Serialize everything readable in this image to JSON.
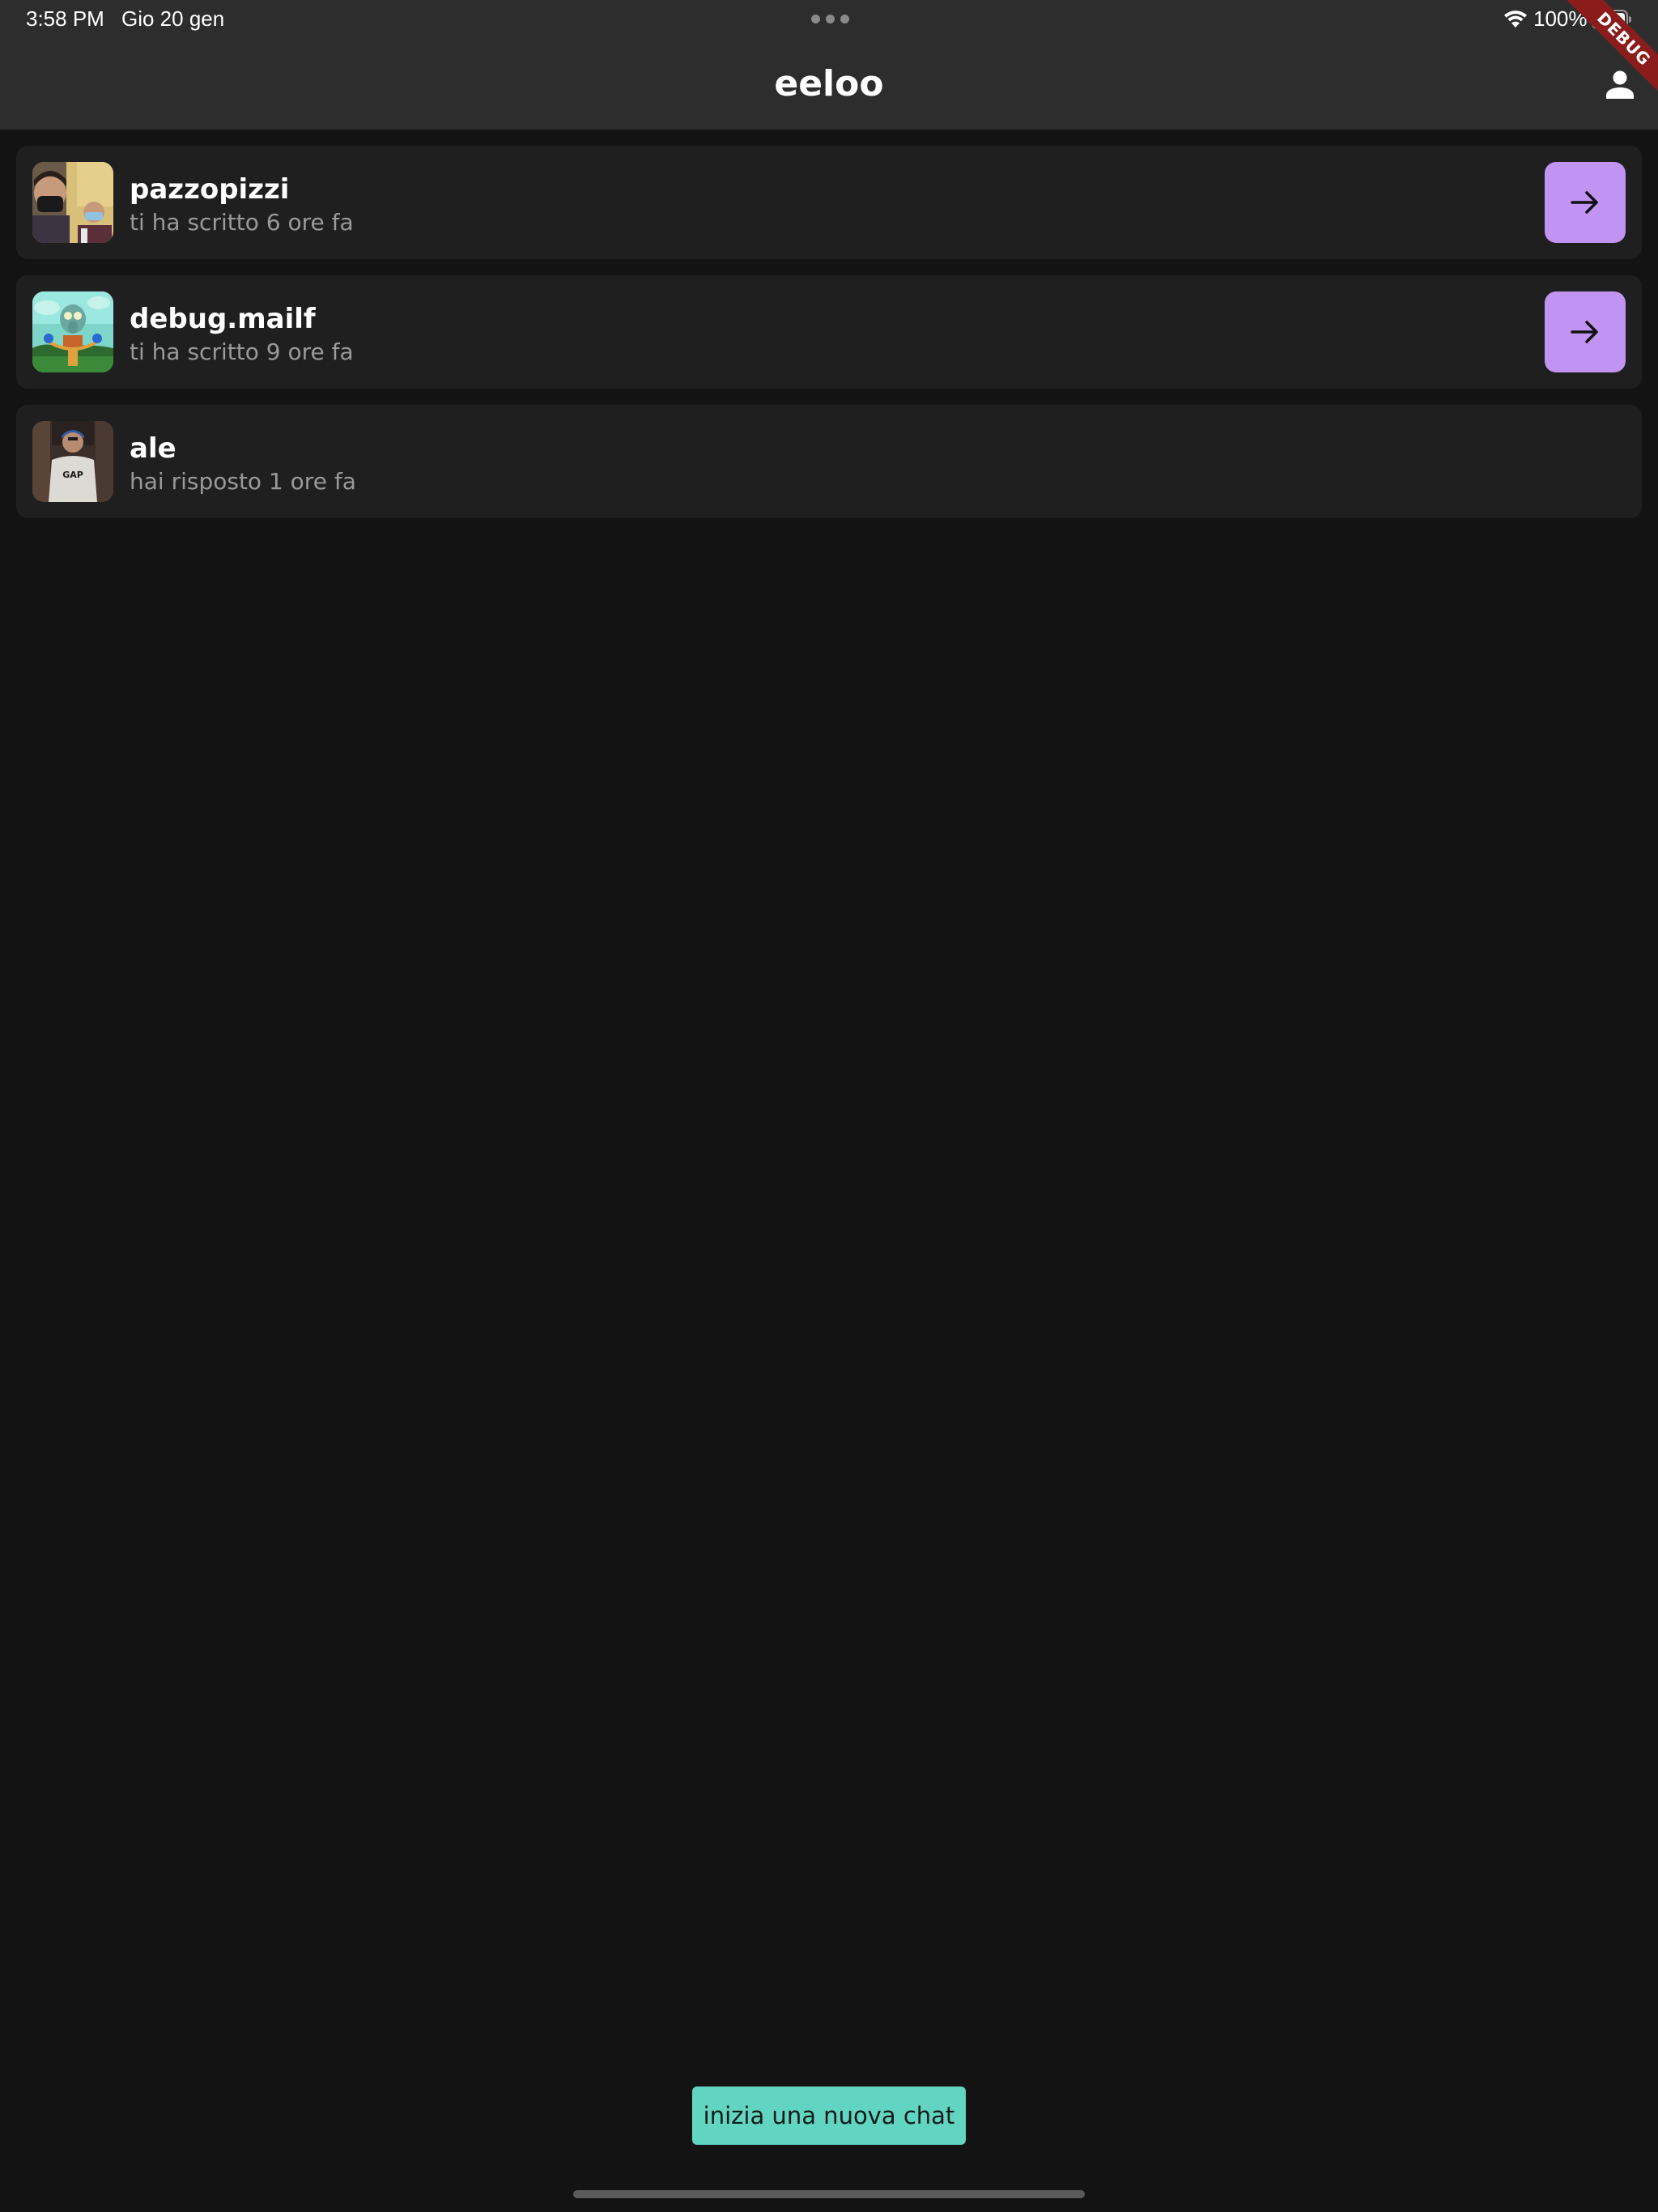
{
  "status_bar": {
    "time": "3:58 PM",
    "date": "Gio 20 gen",
    "battery": "100%",
    "wifi_icon": "wifi-icon",
    "battery_icon": "battery-full-icon"
  },
  "debug_banner": "DEBUG",
  "app_bar": {
    "title": "eeloo",
    "profile_icon": "person-icon"
  },
  "chats": [
    {
      "name": "pazzopizzi",
      "subtitle": "ti ha scritto 6 ore fa",
      "has_arrow": true
    },
    {
      "name": "debug.mailf",
      "subtitle": "ti ha scritto 9 ore fa",
      "has_arrow": true
    },
    {
      "name": "ale",
      "subtitle": "hai risposto 1 ore fa",
      "has_arrow": false
    }
  ],
  "new_chat_button": "inizia una nuova chat",
  "colors": {
    "background": "#131313",
    "app_bar": "#2d2d2d",
    "card": "#1f1f1f",
    "accent_purple": "#c193f2",
    "accent_teal": "#62d4c2",
    "debug_red": "#8c1c1c"
  }
}
